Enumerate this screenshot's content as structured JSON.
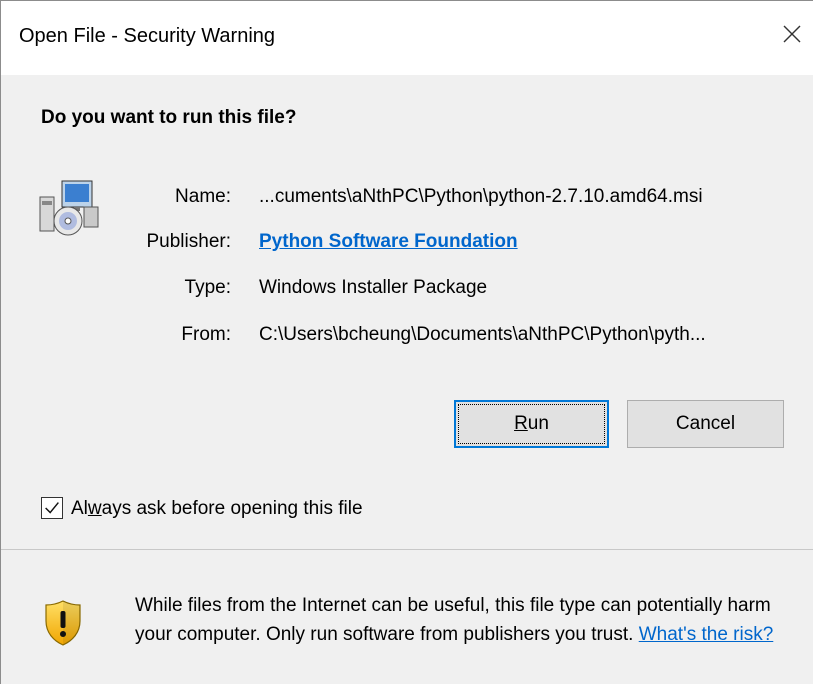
{
  "window": {
    "title": "Open File - Security Warning"
  },
  "headline": "Do you want to run this file?",
  "fields": [
    {
      "label": "Name:",
      "value": "...cuments\\aNthPC\\Python\\python-2.7.10.amd64.msi"
    },
    {
      "label": "Publisher:",
      "value": "Python Software Foundation"
    },
    {
      "label": "Type:",
      "value": "Windows Installer Package"
    },
    {
      "label": "From:",
      "value": "C:\\Users\\bcheung\\Documents\\aNthPC\\Python\\pyth..."
    }
  ],
  "buttons": {
    "run": {
      "prefix": "",
      "mnemonic": "R",
      "rest": "un"
    },
    "cancel": "Cancel"
  },
  "checkbox": {
    "checked": true,
    "pre": "Al",
    "mnemonic": "w",
    "post": "ays ask before opening this file"
  },
  "warning": {
    "text": "While files from the Internet can be useful, this file type can potentially harm your computer. Only run software from publishers you trust.",
    "link": "What's the risk?"
  },
  "icons": {
    "file": "installer-package-icon",
    "shield": "warning-shield-icon",
    "close": "close-icon"
  },
  "colors": {
    "link": "#0066cc",
    "focus": "#0078d7",
    "warning_band": "#ffffff"
  }
}
